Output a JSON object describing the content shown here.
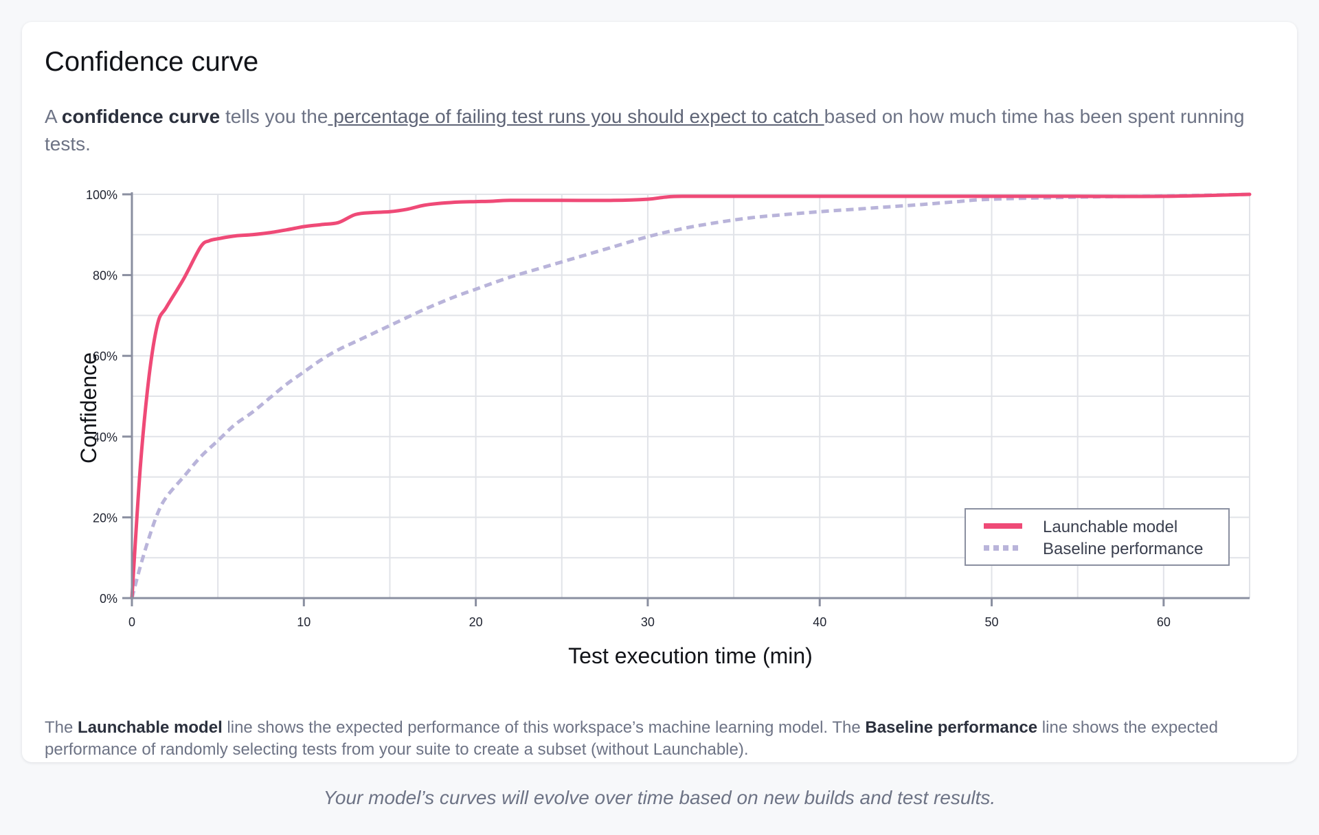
{
  "card": {
    "title": "Confidence curve",
    "intro": {
      "prefix": "A ",
      "bold": "confidence curve",
      "middle": " tells you the",
      "link": " percentage of failing test runs you should expect to catch ",
      "suffix": "based on how much time has been spent running tests."
    },
    "footnote": {
      "p1": "The ",
      "b1": "Launchable model",
      "p2": " line shows the expected performance of this workspace’s machine learning model. The ",
      "b2": "Baseline performance",
      "p3": " line shows the expected performance of randomly selecting tests from your suite to create a subset (without Launchable)."
    }
  },
  "caption": "Your model’s curves will evolve over time based on new builds and test results.",
  "chart_data": {
    "type": "line",
    "title": "",
    "xlabel": "Test execution time (min)",
    "ylabel": "Confidence",
    "xlim": [
      0,
      65
    ],
    "ylim": [
      0,
      100
    ],
    "xticks": [
      0,
      10,
      20,
      30,
      40,
      50,
      60
    ],
    "yticks": [
      0,
      20,
      40,
      60,
      80,
      100
    ],
    "ytick_labels": [
      "0%",
      "20%",
      "40%",
      "60%",
      "80%",
      "100%"
    ],
    "grid": true,
    "grid_step_x": 5,
    "grid_step_y": 10,
    "legend_position": "bottom-right",
    "colors": {
      "launchable": "#ef4a77",
      "baseline": "#b9b4da",
      "axis": "#8a8fa0",
      "grid": "#e1e3e8",
      "legend_border": "#8a8fa0"
    },
    "series": [
      {
        "name": "Launchable model",
        "style": "solid",
        "x": [
          0,
          0.5,
          1,
          1.5,
          2,
          3,
          4,
          4.5,
          5,
          6,
          7,
          8,
          9,
          10,
          11,
          12,
          13,
          14,
          15,
          16,
          17,
          18,
          19,
          20,
          21,
          22,
          25,
          28,
          30,
          31,
          32,
          35,
          40,
          45,
          50,
          55,
          60,
          65
        ],
        "y": [
          0,
          33,
          55,
          68,
          72,
          79,
          87,
          88.5,
          89,
          89.7,
          90,
          90.5,
          91.2,
          92,
          92.5,
          93,
          95,
          95.5,
          95.7,
          96.3,
          97.3,
          97.8,
          98.1,
          98.2,
          98.3,
          98.5,
          98.5,
          98.5,
          98.8,
          99.3,
          99.5,
          99.5,
          99.5,
          99.5,
          99.5,
          99.5,
          99.5,
          100
        ]
      },
      {
        "name": "Baseline performance",
        "style": "dashed",
        "x": [
          0,
          0.5,
          1,
          1.5,
          2,
          3,
          4,
          5,
          6,
          7,
          8,
          9,
          10,
          11,
          12,
          13,
          14,
          15,
          16,
          17,
          18,
          19,
          20,
          22,
          24,
          26,
          28,
          30,
          32,
          34,
          36,
          38,
          40,
          42,
          44,
          46,
          48,
          50,
          55,
          60,
          65
        ],
        "y": [
          0,
          8,
          15,
          21,
          25,
          30,
          35,
          39,
          43,
          46,
          49.5,
          53,
          56,
          59,
          61.5,
          63.5,
          65.5,
          67.5,
          69.5,
          71.5,
          73.3,
          75,
          76.5,
          79.5,
          82,
          84.5,
          87,
          89.5,
          91.5,
          93,
          94.2,
          95,
          95.7,
          96.3,
          96.9,
          97.5,
          98.2,
          98.8,
          99.3,
          99.6,
          100
        ]
      }
    ]
  }
}
